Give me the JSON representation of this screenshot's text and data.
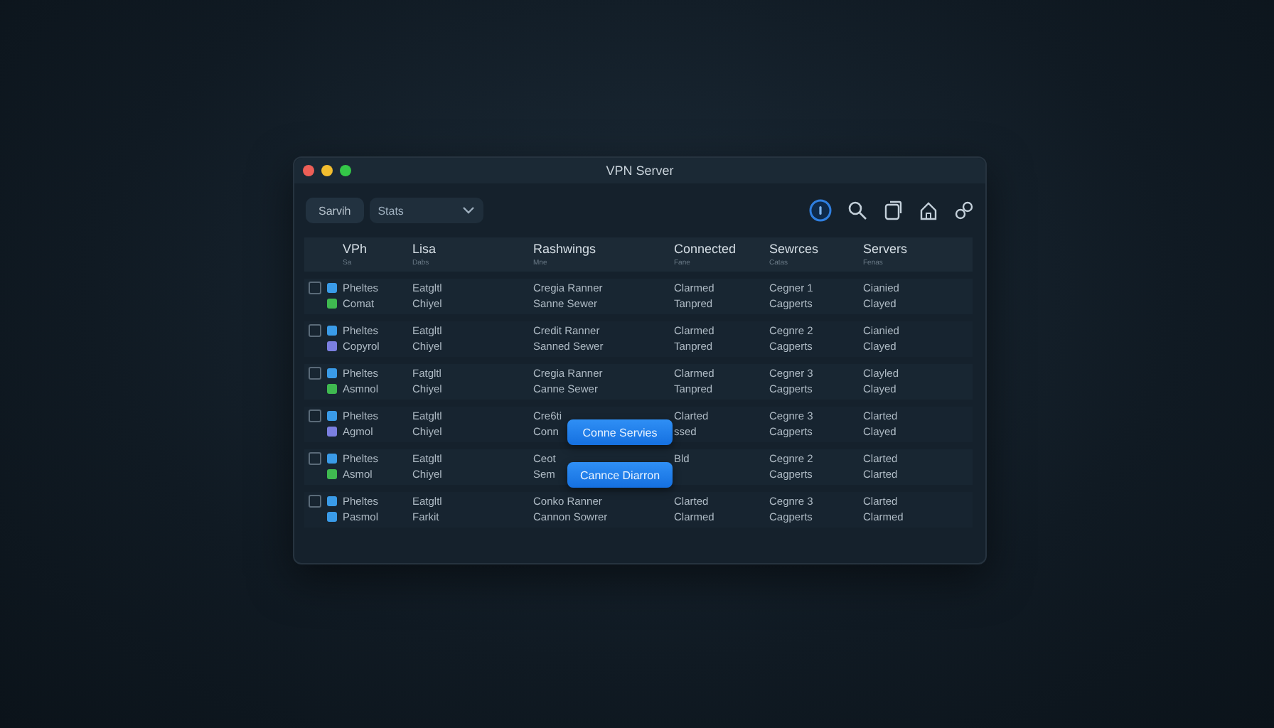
{
  "window": {
    "title": "VPN Server"
  },
  "toolbar": {
    "button": "Sarvih",
    "dropdown": "Stats"
  },
  "table": {
    "columns": [
      {
        "label": "VPh",
        "sub": "Sa"
      },
      {
        "label": "Lisa",
        "sub": "Dabs"
      },
      {
        "label": "Rashwings",
        "sub": "Mne"
      },
      {
        "label": "Connected",
        "sub": "Fane"
      },
      {
        "label": "Sewrces",
        "sub": "Catas"
      },
      {
        "label": "Servers",
        "sub": "Fenas"
      }
    ],
    "rows": [
      {
        "checked": false,
        "lines": [
          {
            "color": "#3a9be8",
            "cells": [
              "Pheltes",
              "Eatgltl",
              "Cregia Ranner",
              "Clarmed",
              "Cegner 1",
              "Cianied"
            ]
          },
          {
            "color": "#3fb950",
            "cells": [
              "Comat",
              "Chiyel",
              "Sanne Sewer",
              "Tanpred",
              "Cagperts",
              "Clayed"
            ]
          }
        ]
      },
      {
        "checked": false,
        "lines": [
          {
            "color": "#3a9be8",
            "cells": [
              "Pheltes",
              "Eatgltl",
              "Credit Ranner",
              "Clarmed",
              "Cegnre 2",
              "Cianied"
            ]
          },
          {
            "color": "#7b7fe0",
            "cells": [
              "Copyrol",
              "Chiyel",
              "Sanned Sewer",
              "Tanpred",
              "Cagperts",
              "Clayed"
            ]
          }
        ]
      },
      {
        "checked": false,
        "lines": [
          {
            "color": "#3a9be8",
            "cells": [
              "Pheltes",
              "Fatgltl",
              "Cregia Ranner",
              "Clarmed",
              "Cegner 3",
              "Clayled"
            ]
          },
          {
            "color": "#3fb950",
            "cells": [
              "Asmnol",
              "Chiyel",
              "Canne Sewer",
              "Tanpred",
              "Cagperts",
              "Clayed"
            ]
          }
        ]
      },
      {
        "checked": false,
        "lines": [
          {
            "color": "#3a9be8",
            "cells": [
              "Pheltes",
              "Eatgltl",
              "Cre6ti",
              "Clarted",
              "Cegnre 3",
              "Clarted"
            ]
          },
          {
            "color": "#7b7fe0",
            "cells": [
              "Agmol",
              "Chiyel",
              "Conn",
              "ssed",
              "Cagperts",
              "Clayed"
            ]
          }
        ]
      },
      {
        "checked": false,
        "lines": [
          {
            "color": "#3a9be8",
            "cells": [
              "Pheltes",
              "Eatgltl",
              "Ceot",
              "Bld",
              "Cegnre 2",
              "Clarted"
            ]
          },
          {
            "color": "#3fb950",
            "cells": [
              "Asmol",
              "Chiyel",
              "Sem",
              null,
              "Cagperts",
              "Clarted"
            ]
          }
        ]
      },
      {
        "checked": false,
        "lines": [
          {
            "color": "#3a9be8",
            "cells": [
              "Pheltes",
              "Eatgltl",
              "Conko Ranner",
              "Clarted",
              "Cegnre 3",
              "Clarted"
            ]
          },
          {
            "color": "#3a9be8",
            "cells": [
              "Pasmol",
              "Farkit",
              "Cannon Sowrer",
              "Clarmed",
              "Cagperts",
              "Clarmed"
            ]
          }
        ]
      }
    ]
  },
  "overlay_buttons": [
    "Conne Servies",
    "Cannce Diarron"
  ]
}
